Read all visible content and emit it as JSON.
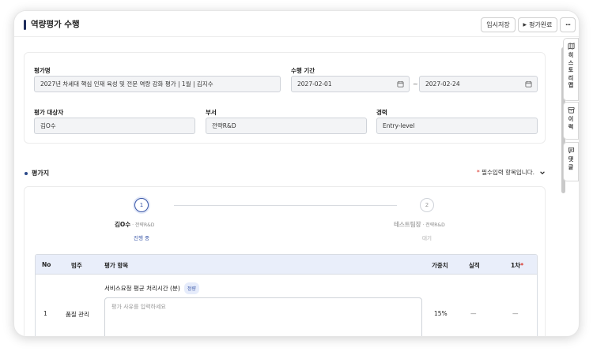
{
  "header": {
    "title": "역량평가 수행",
    "save_label": "임시저장",
    "complete_label": "평가완료",
    "more_label": "···"
  },
  "info": {
    "eval_name_label": "평가명",
    "eval_name_value": "2027년 차세대 핵심 인재 육성 및 전문 역량 강화 평가 | 1월 | 김지수",
    "period_label": "수행 기간",
    "period_start": "2027-02-01",
    "period_sep": "~",
    "period_end": "2027-02-24",
    "target_label": "평가 대상자",
    "target_value": "김O수",
    "dept_label": "부서",
    "dept_value": "전략R&D",
    "career_label": "경력",
    "career_value": "Entry-level"
  },
  "section": {
    "title": "평가지",
    "required_star": "*",
    "required_text": "필수입력 항목입니다."
  },
  "steps": [
    {
      "num": "1",
      "name": "김O수",
      "dept": " · 전략R&D",
      "status": "진행 중"
    },
    {
      "num": "2",
      "name": "테스트팀장",
      "dept": " · 전략R&D",
      "status": "대기"
    }
  ],
  "table": {
    "headers": {
      "no": "No",
      "category": "범주",
      "item": "평가 항목",
      "weight": "가중치",
      "actual": "실적",
      "first": "1차",
      "first_star": "*"
    },
    "rows": [
      {
        "no": "1",
        "category": "품질 관리",
        "item": "서비스요청 평균 처리시간 (분)",
        "badge": "정량",
        "placeholder": "평가 사유를 입력하세요",
        "weight": "15%",
        "actual": "—",
        "first": "—"
      }
    ]
  },
  "sidebar": {
    "history_map": "히스토리맵",
    "history": "이력",
    "comment": "댓글"
  },
  "colors": {
    "accent_dark": "#1f2d5c",
    "accent_blue": "#3a57a8",
    "required_red": "#d93025",
    "table_header_bg": "#e9eefa"
  }
}
